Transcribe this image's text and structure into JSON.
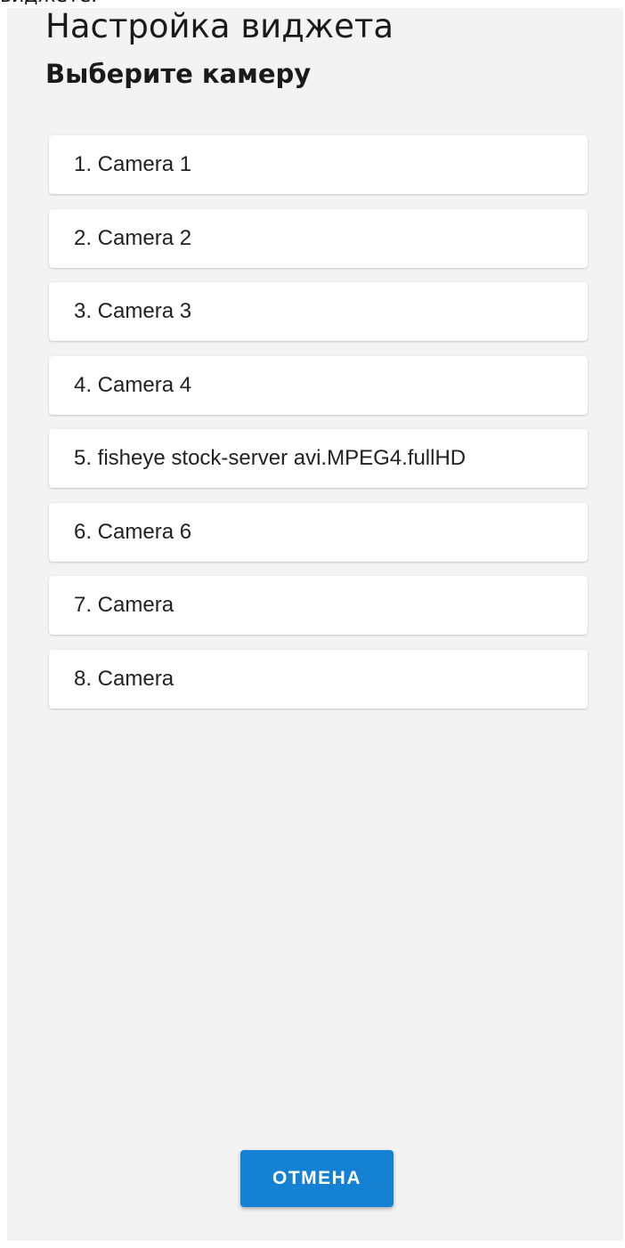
{
  "clipped_caption": "виджете.",
  "dialog": {
    "title": "Настройка виджета",
    "subtitle": "Выберите камеру"
  },
  "cameras": [
    {
      "label": "1. Camera 1"
    },
    {
      "label": "2. Camera 2"
    },
    {
      "label": "3. Camera 3"
    },
    {
      "label": "4. Camera 4"
    },
    {
      "label": "5. fisheye stock-server avi.MPEG4.fullHD"
    },
    {
      "label": "6. Camera 6"
    },
    {
      "label": "7. Camera"
    },
    {
      "label": "8. Camera"
    }
  ],
  "actions": {
    "cancel_label": "ОТМЕНА"
  },
  "colors": {
    "background": "#f3f3f3",
    "card": "#ffffff",
    "accent": "#1581d3"
  }
}
